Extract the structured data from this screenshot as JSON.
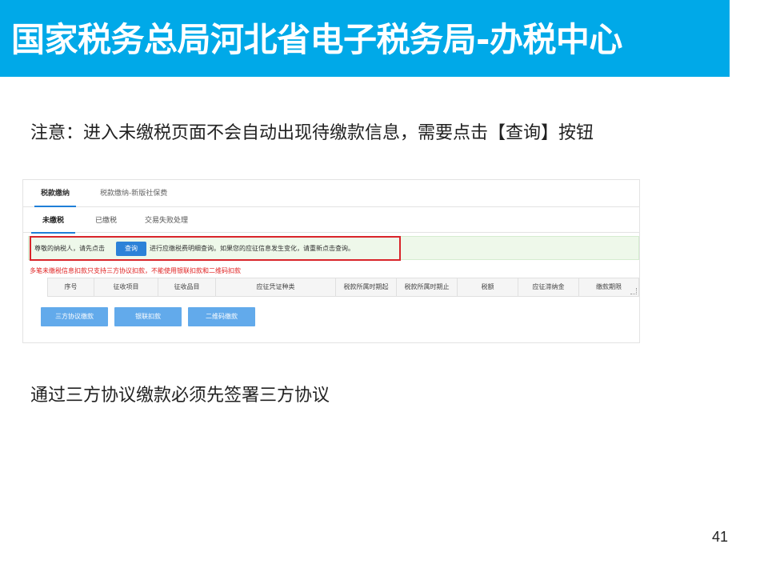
{
  "slide": {
    "title": "国家税务总局河北省电子税务局-办税中心",
    "note": "注意：进入未缴税页面不会自动出现待缴款信息，需要点击【查询】按钮",
    "note2": "通过三方协议缴款必须先签署三方协议",
    "page_number": "41"
  },
  "app": {
    "top_tabs": [
      "税款缴纳",
      "税款缴纳-新版社保费"
    ],
    "sub_tabs": [
      "未缴税",
      "已缴税",
      "交易失败处理"
    ],
    "info_prefix": "尊敬的纳税人，请先点击",
    "query_label": "查询",
    "info_suffix": "进行应缴税费明细查询。如果您的应征信息发生变化，请重新点击查询。",
    "warning": "多笔未缴税信息扣款只支持三方协议扣款，不能使用银联扣款和二维码扣款",
    "table_columns": [
      "序号",
      "征收项目",
      "征收品目",
      "应征凭证种类",
      "税款所属时期起",
      "税款所属时期止",
      "税额",
      "应征滞纳金",
      "缴款期限"
    ],
    "buttons": [
      "三方协议缴款",
      "银联扣款",
      "二维码缴款"
    ]
  },
  "colors": {
    "banner": "#00a9e8",
    "highlight": "#d9242a",
    "button": "#62aaeb",
    "warning_text": "#e02020"
  }
}
